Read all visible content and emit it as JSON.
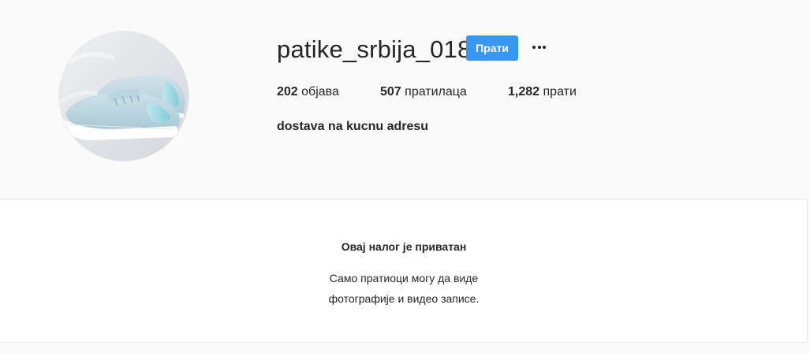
{
  "profile": {
    "username": "patike_srbija_018",
    "follow_label": "Прати",
    "more_icon": "more-options-icon",
    "avatar_icon": "sneaker-photo",
    "bio": "dostava na kucnu adresu"
  },
  "stats": {
    "posts_count": "202",
    "posts_label": "објава",
    "followers_count": "507",
    "followers_label": "пратилаца",
    "following_count": "1,282",
    "following_label": "прати"
  },
  "private_notice": {
    "title": "Овај налог је приватан",
    "line1": "Само пратиоци могу да виде",
    "line2": "фотографије и видео записе."
  },
  "colors": {
    "background": "#fafafa",
    "accent": "#3897f0",
    "text": "#262626",
    "panel": "#ffffff"
  }
}
